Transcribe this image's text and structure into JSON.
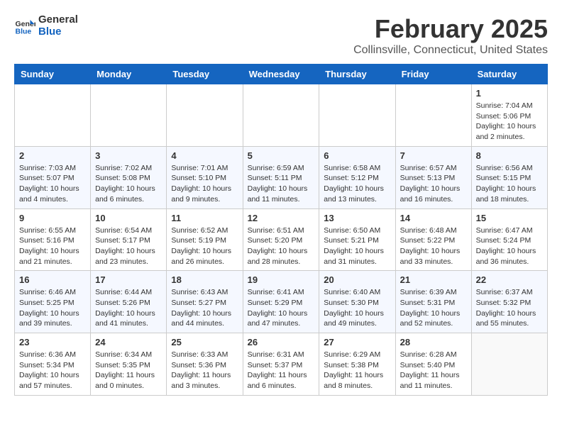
{
  "header": {
    "logo_line1": "General",
    "logo_line2": "Blue",
    "month": "February 2025",
    "location": "Collinsville, Connecticut, United States"
  },
  "weekdays": [
    "Sunday",
    "Monday",
    "Tuesday",
    "Wednesday",
    "Thursday",
    "Friday",
    "Saturday"
  ],
  "weeks": [
    [
      {
        "day": "",
        "info": ""
      },
      {
        "day": "",
        "info": ""
      },
      {
        "day": "",
        "info": ""
      },
      {
        "day": "",
        "info": ""
      },
      {
        "day": "",
        "info": ""
      },
      {
        "day": "",
        "info": ""
      },
      {
        "day": "1",
        "info": "Sunrise: 7:04 AM\nSunset: 5:06 PM\nDaylight: 10 hours and 2 minutes."
      }
    ],
    [
      {
        "day": "2",
        "info": "Sunrise: 7:03 AM\nSunset: 5:07 PM\nDaylight: 10 hours and 4 minutes."
      },
      {
        "day": "3",
        "info": "Sunrise: 7:02 AM\nSunset: 5:08 PM\nDaylight: 10 hours and 6 minutes."
      },
      {
        "day": "4",
        "info": "Sunrise: 7:01 AM\nSunset: 5:10 PM\nDaylight: 10 hours and 9 minutes."
      },
      {
        "day": "5",
        "info": "Sunrise: 6:59 AM\nSunset: 5:11 PM\nDaylight: 10 hours and 11 minutes."
      },
      {
        "day": "6",
        "info": "Sunrise: 6:58 AM\nSunset: 5:12 PM\nDaylight: 10 hours and 13 minutes."
      },
      {
        "day": "7",
        "info": "Sunrise: 6:57 AM\nSunset: 5:13 PM\nDaylight: 10 hours and 16 minutes."
      },
      {
        "day": "8",
        "info": "Sunrise: 6:56 AM\nSunset: 5:15 PM\nDaylight: 10 hours and 18 minutes."
      }
    ],
    [
      {
        "day": "9",
        "info": "Sunrise: 6:55 AM\nSunset: 5:16 PM\nDaylight: 10 hours and 21 minutes."
      },
      {
        "day": "10",
        "info": "Sunrise: 6:54 AM\nSunset: 5:17 PM\nDaylight: 10 hours and 23 minutes."
      },
      {
        "day": "11",
        "info": "Sunrise: 6:52 AM\nSunset: 5:19 PM\nDaylight: 10 hours and 26 minutes."
      },
      {
        "day": "12",
        "info": "Sunrise: 6:51 AM\nSunset: 5:20 PM\nDaylight: 10 hours and 28 minutes."
      },
      {
        "day": "13",
        "info": "Sunrise: 6:50 AM\nSunset: 5:21 PM\nDaylight: 10 hours and 31 minutes."
      },
      {
        "day": "14",
        "info": "Sunrise: 6:48 AM\nSunset: 5:22 PM\nDaylight: 10 hours and 33 minutes."
      },
      {
        "day": "15",
        "info": "Sunrise: 6:47 AM\nSunset: 5:24 PM\nDaylight: 10 hours and 36 minutes."
      }
    ],
    [
      {
        "day": "16",
        "info": "Sunrise: 6:46 AM\nSunset: 5:25 PM\nDaylight: 10 hours and 39 minutes."
      },
      {
        "day": "17",
        "info": "Sunrise: 6:44 AM\nSunset: 5:26 PM\nDaylight: 10 hours and 41 minutes."
      },
      {
        "day": "18",
        "info": "Sunrise: 6:43 AM\nSunset: 5:27 PM\nDaylight: 10 hours and 44 minutes."
      },
      {
        "day": "19",
        "info": "Sunrise: 6:41 AM\nSunset: 5:29 PM\nDaylight: 10 hours and 47 minutes."
      },
      {
        "day": "20",
        "info": "Sunrise: 6:40 AM\nSunset: 5:30 PM\nDaylight: 10 hours and 49 minutes."
      },
      {
        "day": "21",
        "info": "Sunrise: 6:39 AM\nSunset: 5:31 PM\nDaylight: 10 hours and 52 minutes."
      },
      {
        "day": "22",
        "info": "Sunrise: 6:37 AM\nSunset: 5:32 PM\nDaylight: 10 hours and 55 minutes."
      }
    ],
    [
      {
        "day": "23",
        "info": "Sunrise: 6:36 AM\nSunset: 5:34 PM\nDaylight: 10 hours and 57 minutes."
      },
      {
        "day": "24",
        "info": "Sunrise: 6:34 AM\nSunset: 5:35 PM\nDaylight: 11 hours and 0 minutes."
      },
      {
        "day": "25",
        "info": "Sunrise: 6:33 AM\nSunset: 5:36 PM\nDaylight: 11 hours and 3 minutes."
      },
      {
        "day": "26",
        "info": "Sunrise: 6:31 AM\nSunset: 5:37 PM\nDaylight: 11 hours and 6 minutes."
      },
      {
        "day": "27",
        "info": "Sunrise: 6:29 AM\nSunset: 5:38 PM\nDaylight: 11 hours and 8 minutes."
      },
      {
        "day": "28",
        "info": "Sunrise: 6:28 AM\nSunset: 5:40 PM\nDaylight: 11 hours and 11 minutes."
      },
      {
        "day": "",
        "info": ""
      }
    ]
  ]
}
